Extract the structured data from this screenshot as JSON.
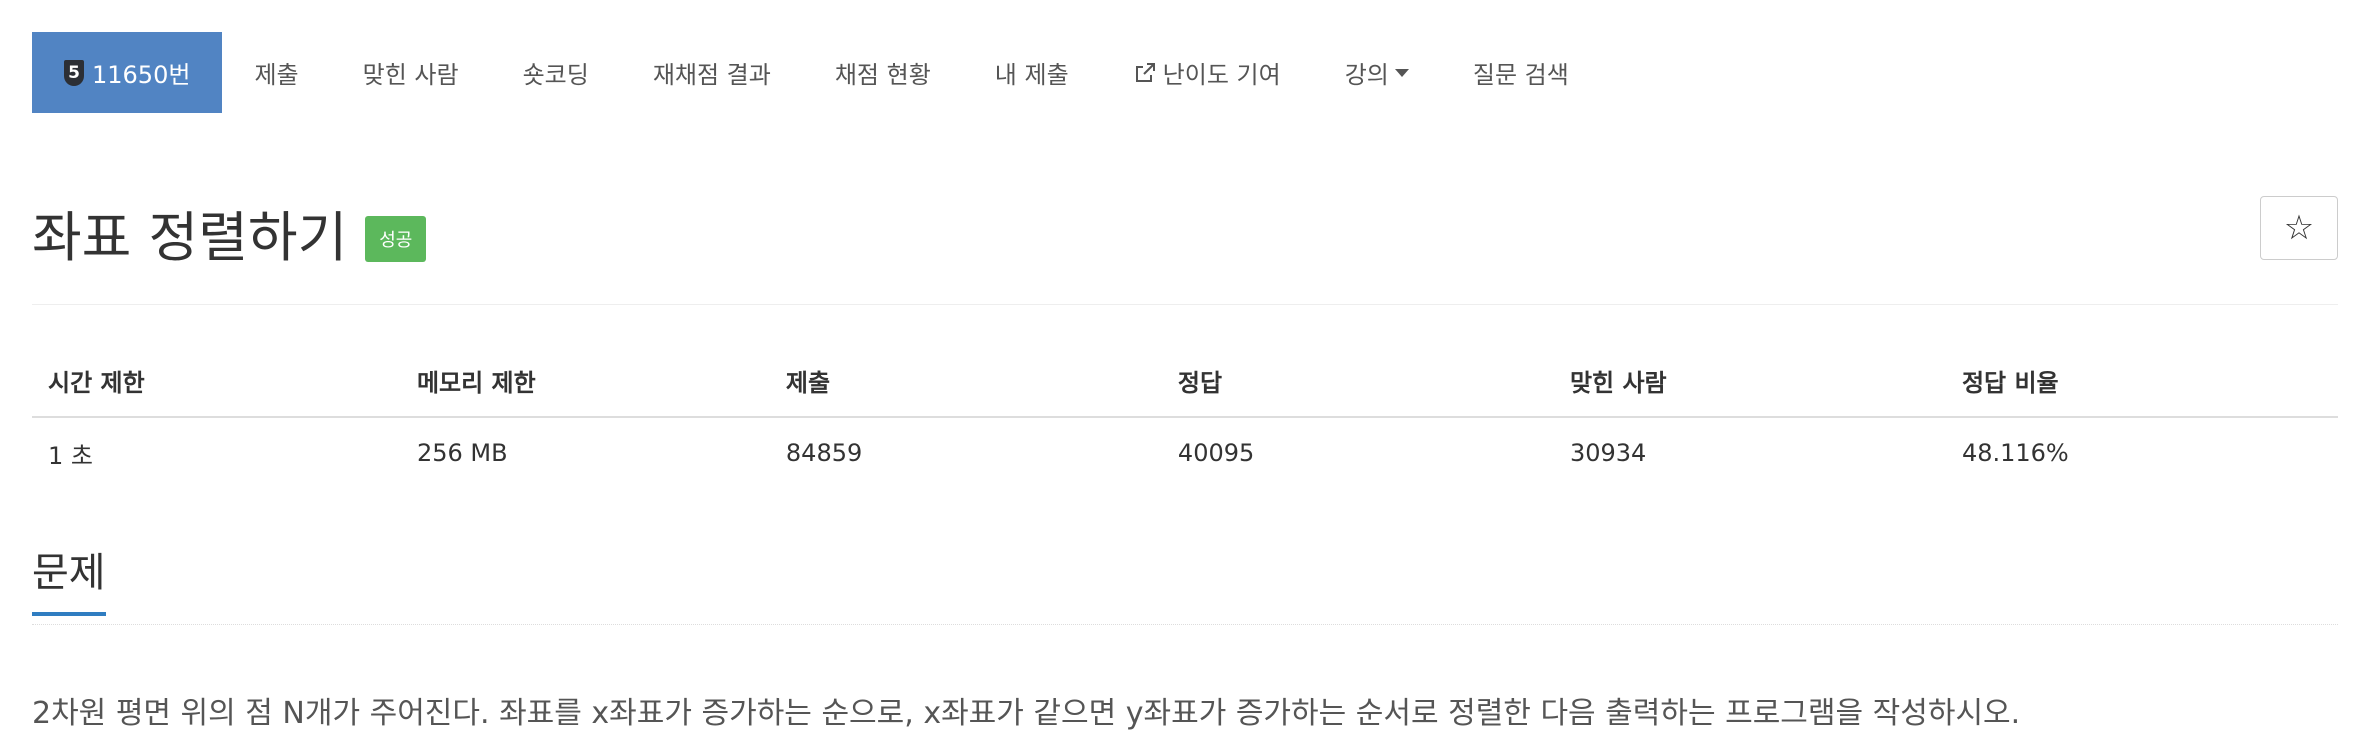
{
  "nav": {
    "problem_tier": "5",
    "problem_id": "11650번",
    "items": [
      "제출",
      "맞힌 사람",
      "숏코딩",
      "재채점 결과",
      "채점 현황",
      "내 제출",
      "난이도 기여",
      "강의",
      "질문 검색"
    ]
  },
  "problem": {
    "title": "좌표 정렬하기",
    "status_badge": "성공",
    "star": "☆"
  },
  "info_table": {
    "headers": [
      "시간 제한",
      "메모리 제한",
      "제출",
      "정답",
      "맞힌 사람",
      "정답 비율"
    ],
    "values": [
      "1 초",
      "256 MB",
      "84859",
      "40095",
      "30934",
      "48.116%"
    ]
  },
  "section": {
    "title": "문제",
    "description": "2차원 평면 위의 점 N개가 주어진다. 좌표를 x좌표가 증가하는 순으로, x좌표가 같으면 y좌표가 증가하는 순서로 정렬한 다음 출력하는 프로그램을 작성하시오."
  },
  "colors": {
    "active_tab": "#5184c3",
    "success_badge": "#5cb85c",
    "section_underline": "#2f7dc1"
  }
}
